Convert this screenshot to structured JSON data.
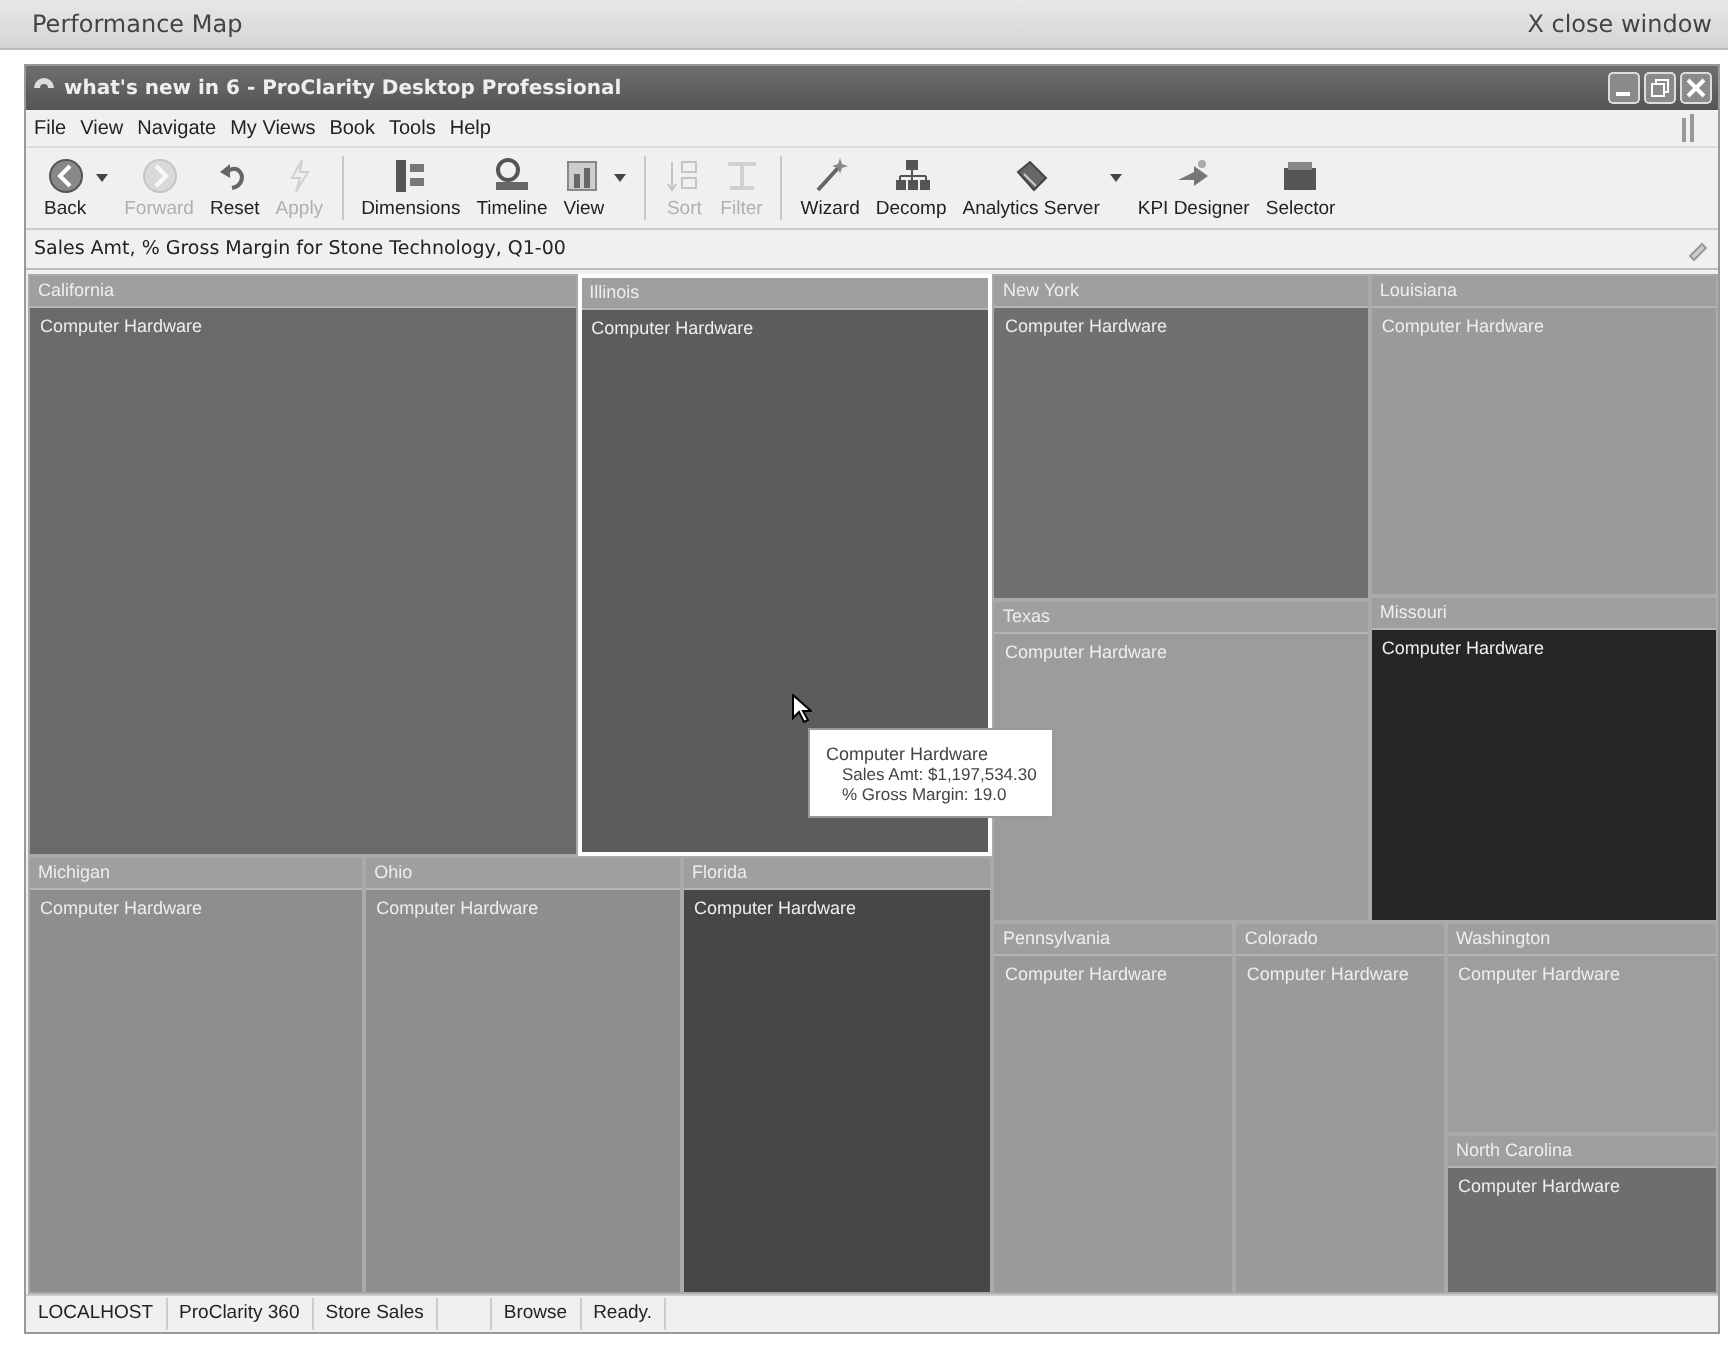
{
  "page": {
    "title": "Performance Map",
    "close_link": "X close window"
  },
  "window": {
    "title": "what's new in 6 - ProClarity Desktop Professional"
  },
  "menu": [
    "File",
    "View",
    "Navigate",
    "My Views",
    "Book",
    "Tools",
    "Help"
  ],
  "toolbar": [
    {
      "label": "Back",
      "disabled": false,
      "dropdown": true
    },
    {
      "label": "Forward",
      "disabled": true,
      "dropdown": false
    },
    {
      "label": "Reset",
      "disabled": false,
      "dropdown": false
    },
    {
      "label": "Apply",
      "disabled": true,
      "dropdown": false
    },
    {
      "label": "Dimensions",
      "disabled": false,
      "dropdown": false
    },
    {
      "label": "Timeline",
      "disabled": false,
      "dropdown": false
    },
    {
      "label": "View",
      "disabled": false,
      "dropdown": true
    },
    {
      "label": "Sort",
      "disabled": true,
      "dropdown": false
    },
    {
      "label": "Filter",
      "disabled": true,
      "dropdown": false
    },
    {
      "label": "Wizard",
      "disabled": false,
      "dropdown": false
    },
    {
      "label": "Decomp",
      "disabled": false,
      "dropdown": false
    },
    {
      "label": "Analytics Server",
      "disabled": false,
      "dropdown": true
    },
    {
      "label": "KPI Designer",
      "disabled": false,
      "dropdown": false
    },
    {
      "label": "Selector",
      "disabled": false,
      "dropdown": false
    }
  ],
  "caption": "Sales Amt, % Gross Margin for Stone Technology, Q1-00",
  "tiles": [
    {
      "region": "California",
      "label": "Computer Hardware",
      "color": "#6a6a6a",
      "selected": false
    },
    {
      "region": "Illinois",
      "label": "Computer Hardware",
      "color": "#5c5c5c",
      "selected": true
    },
    {
      "region": "New York",
      "label": "Computer Hardware",
      "color": "#707070",
      "selected": false
    },
    {
      "region": "Louisiana",
      "label": "Computer Hardware",
      "color": "#9a9a9a",
      "selected": false
    },
    {
      "region": "Texas",
      "label": "Computer Hardware",
      "color": "#9c9c9c",
      "selected": false
    },
    {
      "region": "Missouri",
      "label": "Computer Hardware",
      "color": "#262626",
      "selected": false
    },
    {
      "region": "Michigan",
      "label": "Computer Hardware",
      "color": "#8e8e8e",
      "selected": false
    },
    {
      "region": "Ohio",
      "label": "Computer Hardware",
      "color": "#8e8e8e",
      "selected": false
    },
    {
      "region": "Florida",
      "label": "Computer Hardware",
      "color": "#474747",
      "selected": false
    },
    {
      "region": "Pennsylvania",
      "label": "Computer Hardware",
      "color": "#9a9a9a",
      "selected": false
    },
    {
      "region": "Colorado",
      "label": "Computer Hardware",
      "color": "#9a9a9a",
      "selected": false
    },
    {
      "region": "Washington",
      "label": "Computer Hardware",
      "color": "#9e9e9e",
      "selected": false
    },
    {
      "region": "North Carolina",
      "label": "Computer Hardware",
      "color": "#6e6e6e",
      "selected": false
    }
  ],
  "tooltip": {
    "title": "Computer Hardware",
    "lines": [
      "Sales Amt: $1,197,534.30",
      "% Gross Margin: 19.0"
    ]
  },
  "status_bar": [
    "LOCALHOST",
    "ProClarity 360",
    "Store Sales",
    "Browse",
    "Ready."
  ]
}
